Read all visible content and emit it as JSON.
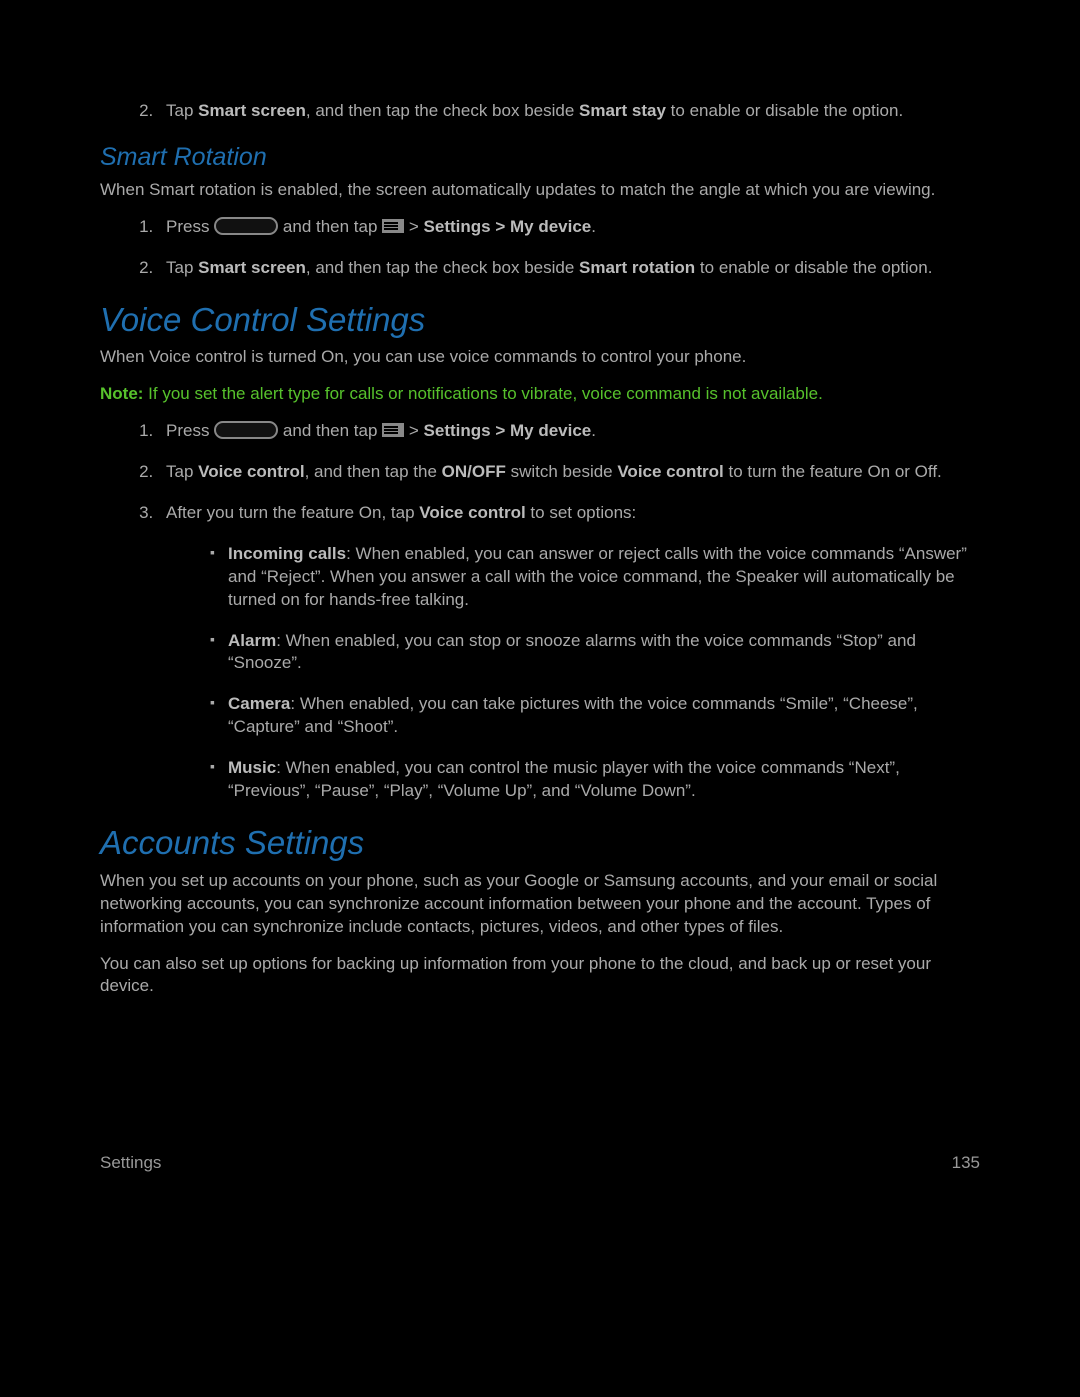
{
  "intro_step2": {
    "prefix": "Tap ",
    "bold1": "Smart screen",
    "mid": ", and then tap the check box beside ",
    "bold2": "Smart stay",
    "suffix": " to enable or disable the option."
  },
  "smart_rotation": {
    "heading": "Smart Rotation",
    "para": "When Smart rotation is enabled, the screen automatically updates to match the angle at which you are viewing.",
    "step1": {
      "press": "Press ",
      "andthen": " and then tap ",
      "gt": " > ",
      "settings": "Settings",
      "mydevice": "My device",
      "period": "."
    },
    "step2": {
      "prefix": "Tap ",
      "bold1": "Smart screen",
      "mid": ", and then tap the check box beside ",
      "bold2": "Smart rotation",
      "suffix": " to enable or disable the option."
    }
  },
  "voice_control": {
    "heading": "Voice Control Settings",
    "para": "When Voice control is turned On, you can use voice commands to control your phone.",
    "note_label": "Note:",
    "note_text": " If you set the alert type for calls or notifications to vibrate, voice command is not available.",
    "step1": {
      "press": "Press ",
      "andthen": " and then tap ",
      "gt": " > ",
      "settings": "Settings",
      "mydevice": "My device",
      "period": "."
    },
    "step2": {
      "prefix": "Tap ",
      "bold1": "Voice control",
      "mid1": ", and then tap the ",
      "bold2": "ON/OFF",
      "mid2": " switch beside ",
      "bold3": "Voice control",
      "suffix": " to turn the feature On or Off."
    },
    "step3": {
      "prefix": "After you turn the feature On, tap ",
      "bold1": "Voice control",
      "suffix": " to set options:"
    },
    "bullets": {
      "incoming_label": "Incoming calls",
      "incoming_text": ": When enabled, you can answer or reject calls with the voice commands “Answer” and “Reject”. When you answer a call with the voice command, the Speaker will automatically be turned on for hands-free talking.",
      "alarm_label": "Alarm",
      "alarm_text": ": When enabled, you can stop or snooze alarms with the voice commands “Stop” and “Snooze”.",
      "camera_label": "Camera",
      "camera_text": ": When enabled, you can take pictures with the voice commands “Smile”, “Cheese”, “Capture” and “Shoot”.",
      "music_label": "Music",
      "music_text": ": When enabled, you can control the music player with the voice commands “Next”, “Previous”, “Pause”, “Play”, “Volume Up”, and “Volume Down”."
    }
  },
  "accounts": {
    "heading": "Accounts Settings",
    "para1": "When you set up accounts on your phone, such as your Google or Samsung accounts, and your email or social networking accounts, you can synchronize account information between your phone and the account. Types of information you can synchronize include contacts, pictures, videos, and other types of files.",
    "para2": "You can also set up options for backing up information from your phone to the cloud, and back up or reset your device."
  },
  "footer": {
    "left": "Settings",
    "right": "135"
  }
}
